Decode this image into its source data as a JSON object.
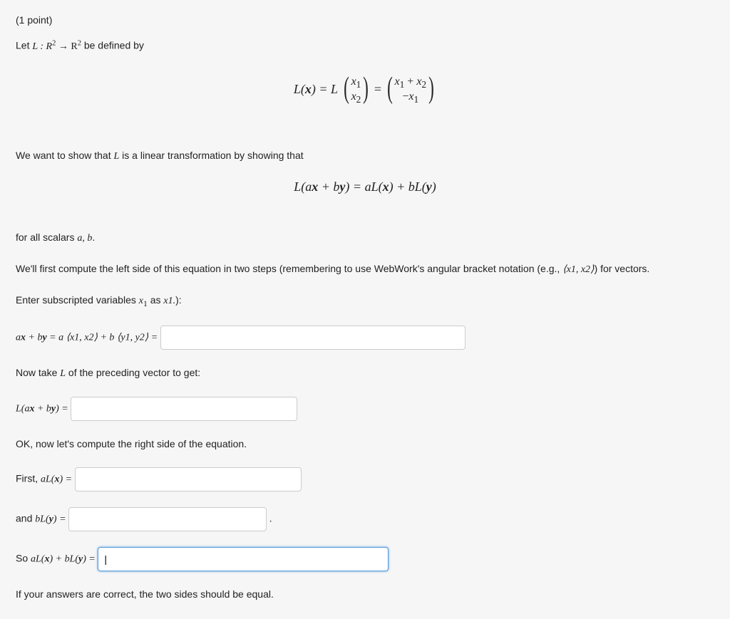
{
  "point_label": "(1 point)",
  "intro_pre": "Let ",
  "intro_math": "L : R",
  "intro_sup": "2",
  "intro_arrow": " → R",
  "intro_post": " be defined by",
  "eq1_lhs": "L(",
  "eq1_x": "x",
  "eq1_cparen": ") = L",
  "eq1_v1": "x",
  "eq1_s1": "1",
  "eq1_v2": "x",
  "eq1_s2": "2",
  "eq1_eq": " = ",
  "eq1_r1a": "x",
  "eq1_r1s1": "1",
  "eq1_plus": " + ",
  "eq1_r1b": "x",
  "eq1_r1s2": "2",
  "eq1_r2neg": "−",
  "eq1_r2v": "x",
  "eq1_r2s": "1",
  "show_pre": "We want to show that ",
  "show_L": "L",
  "show_post": " is a linear transformation by showing that",
  "eq2": "L(a",
  "eq2_x": "x",
  "eq2_mid": " + b",
  "eq2_y": "y",
  "eq2_rp": ") = aL(",
  "eq2_x2": "x",
  "eq2_mid2": ") + bL(",
  "eq2_y2": "y",
  "eq2_end": ")",
  "scalars_pre": "for all scalars ",
  "scalars": "a, b",
  "scalars_post": ".",
  "para_webwork": "We'll first compute the left side of this equation in two steps (remembering to use WebWork's angular bracket notation (e.g., ",
  "wbw_ex": "⟨x1, x2⟩",
  "para_webwork_post": ") for vectors.",
  "enter_pre": "Enter subscripted variables ",
  "enter_x1i": "x",
  "enter_s1": "1",
  "enter_as": " as ",
  "enter_asval": "x1.",
  "enter_post": "):",
  "step1_lhs": "a",
  "step1_x": "x",
  "step1_plus": " + b",
  "step1_y": "y",
  "step1_eq": " = a ⟨x1, x2⟩ + b ⟨y1, y2⟩ = ",
  "step2_pre": "Now take ",
  "step2_L": "L",
  "step2_post": " of the preceding vector to get:",
  "step2_lhs": "L(a",
  "step2_x": "x",
  "step2_mid": " + b",
  "step2_y": "y",
  "step2_eq": ") = ",
  "ok_text": "OK, now let's compute the right side of the equation.",
  "first_pre": "First, ",
  "first_aL": "aL(",
  "first_x": "x",
  "first_post": ") = ",
  "and_pre": "and ",
  "and_bL": "bL(",
  "and_y": "y",
  "and_post": ") = ",
  "and_dot": " .",
  "so_pre": "So ",
  "so_aL": "aL(",
  "so_x": "x",
  "so_mid": ") + bL(",
  "so_y": "y",
  "so_eq": ") = ",
  "final": "If your answers are correct, the two sides should be equal.",
  "input_widths": {
    "w1": "410px",
    "w2": "300px",
    "w3": "300px",
    "w4": "260px",
    "w5": "390px"
  }
}
